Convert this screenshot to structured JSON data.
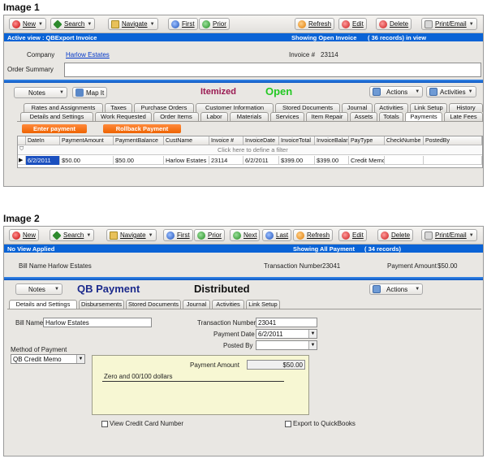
{
  "image1": {
    "caption": "Image 1",
    "toolbar": {
      "new": "New",
      "search": "Search",
      "navigate": "Navigate",
      "first": "First",
      "prior": "Prior",
      "refresh": "Refresh",
      "edit": "Edit",
      "delete": "Delete",
      "print_email": "Print/Email"
    },
    "view_bar": {
      "left": "Active view : QBExport Invoice",
      "showing": "Showing Open Invoice",
      "records": "( 36 records) in view"
    },
    "header": {
      "company_label": "Company",
      "company_value": "Harlow Estates",
      "invoice_label": "Invoice #",
      "invoice_value": "23114",
      "order_summary_label": "Order Summary"
    },
    "action_bar": {
      "notes": "Notes",
      "map_it": "Map It",
      "status_itemized": "Itemized",
      "status_open": "Open",
      "actions": "Actions",
      "activities": "Activities"
    },
    "tabs_row1": [
      "Rates and Assignments",
      "Taxes",
      "Purchase Orders",
      "Customer Information",
      "Stored Documents",
      "Journal",
      "Activities",
      "Link Setup",
      "History"
    ],
    "tabs_row2": [
      "Details and Settings",
      "Work Requested",
      "Order Items",
      "Labor",
      "Materials",
      "Services",
      "Item Repair",
      "Assets",
      "Totals",
      "Payments",
      "Late Fees"
    ],
    "buttons": {
      "enter_payment": "Enter payment",
      "rollback_payment": "Rollback Payment"
    },
    "grid": {
      "columns": [
        "DateIn",
        "PaymentAmount",
        "PaymentBalance",
        "CustName",
        "Invoice #",
        "InvoiceDate",
        "InvoiceTotal",
        "InvoiceBalar",
        "PayType",
        "CheckNumbe",
        "PostedBy"
      ],
      "filter_text": "Click here to define a filter",
      "rows": [
        [
          "6/2/2011",
          "$50.00",
          "$50.00",
          "Harlow Estates",
          "23114",
          "6/2/2011",
          "$399.00",
          "$399.00",
          "Credit Memo",
          "",
          ""
        ]
      ]
    }
  },
  "image2": {
    "caption": "Image 2",
    "toolbar": {
      "new": "New",
      "search": "Search",
      "navigate": "Navigate",
      "first": "First",
      "prior": "Prior",
      "next": "Next",
      "last": "Last",
      "refresh": "Refresh",
      "edit": "Edit",
      "delete": "Delete",
      "print_email": "Print/Email"
    },
    "view_bar": {
      "left": "No View Applied",
      "showing": "Showing All Payment",
      "records": "( 34 records)"
    },
    "header": {
      "bill_name_label": "Bill Name",
      "bill_name_value": "Harlow Estates",
      "transaction_label": "Transaction Number",
      "transaction_value": "23041",
      "amount_label": "Payment Amount",
      "amount_value": "$50.00"
    },
    "action_bar": {
      "notes": "Notes",
      "title": "QB Payment",
      "status": "Distributed",
      "actions": "Actions"
    },
    "tabs": [
      "Details and Settings",
      "Disbursements",
      "Stored Documents",
      "Journal",
      "Activities",
      "Link Setup"
    ],
    "form": {
      "bill_name_label": "Bill Name",
      "bill_name_value": "Harlow Estates",
      "transaction_label": "Transaction Number",
      "transaction_value": "23041",
      "payment_date_label": "Payment Date",
      "payment_date_value": "6/2/2011",
      "posted_by_label": "Posted By",
      "posted_by_value": "",
      "method_label": "Method of Payment",
      "method_value": "QB Credit Memo",
      "payment_amount_label": "Payment Amount",
      "payment_amount_value": "$50.00",
      "words": "Zero and 00/100 dollars",
      "view_cc_label": "View Credit Card Number",
      "export_qb_label": "Export to QuickBooks"
    }
  }
}
